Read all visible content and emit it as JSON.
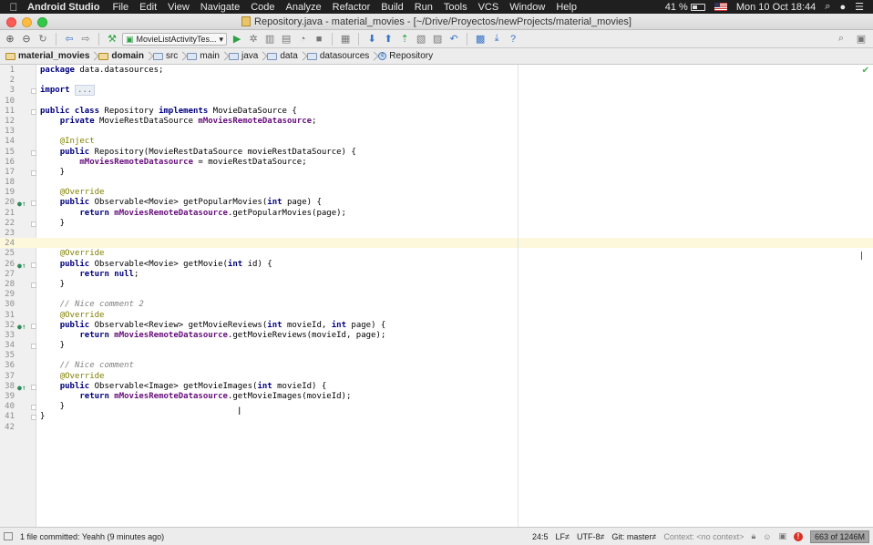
{
  "menubar": {
    "app_name": "Android Studio",
    "items": [
      "File",
      "Edit",
      "View",
      "Navigate",
      "Code",
      "Analyze",
      "Refactor",
      "Build",
      "Run",
      "Tools",
      "VCS",
      "Window",
      "Help"
    ],
    "battery": "41 %",
    "datetime": "Mon 10 Oct  18:44"
  },
  "window": {
    "title": "Repository.java - material_movies - [~/Drive/Proyectos/newProjects/material_movies]"
  },
  "toolbar": {
    "run_config": "MovieListActivityTes..."
  },
  "breadcrumb": [
    "material_movies",
    "domain",
    "src",
    "main",
    "java",
    "data",
    "datasources",
    "Repository"
  ],
  "editor": {
    "lines": [
      {
        "n": "1",
        "html": "<span class=\"kw\">package</span> data.datasources;"
      },
      {
        "n": "2",
        "html": ""
      },
      {
        "n": "3",
        "html": "<span class=\"kw\">import</span> <span class=\"fold-collapsed\">...</span>"
      },
      {
        "n": "10",
        "html": ""
      },
      {
        "n": "11",
        "html": "<span class=\"kw\">public class</span> Repository <span class=\"kw\">implements</span> MovieDataSource {"
      },
      {
        "n": "12",
        "html": "    <span class=\"kw\">private</span> MovieRestDataSource <span class=\"field\">mMoviesRemoteDatasource</span>;"
      },
      {
        "n": "13",
        "html": ""
      },
      {
        "n": "14",
        "html": "    <span class=\"ann\">@Inject</span>"
      },
      {
        "n": "15",
        "html": "    <span class=\"kw\">public</span> Repository(MovieRestDataSource movieRestDataSource) {"
      },
      {
        "n": "16",
        "html": "        <span class=\"field\">mMoviesRemoteDatasource</span> = movieRestDataSource;"
      },
      {
        "n": "17",
        "html": "    }"
      },
      {
        "n": "18",
        "html": ""
      },
      {
        "n": "19",
        "html": "    <span class=\"ann\">@Override</span>"
      },
      {
        "n": "20",
        "html": "    <span class=\"kw\">public</span> Observable&lt;Movie&gt; getPopularMovies(<span class=\"kw\">int</span> page) {"
      },
      {
        "n": "21",
        "html": "        <span class=\"kw\">return</span> <span class=\"field\">mMoviesRemoteDatasource</span>.getPopularMovies(page);"
      },
      {
        "n": "22",
        "html": "    }"
      },
      {
        "n": "23",
        "html": ""
      },
      {
        "n": "24",
        "html": ""
      },
      {
        "n": "25",
        "html": "    <span class=\"ann\">@Override</span>"
      },
      {
        "n": "26",
        "html": "    <span class=\"kw\">public</span> Observable&lt;Movie&gt; getMovie(<span class=\"kw\">int</span> id) {"
      },
      {
        "n": "27",
        "html": "        <span class=\"kw\">return null</span>;"
      },
      {
        "n": "28",
        "html": "    }"
      },
      {
        "n": "29",
        "html": ""
      },
      {
        "n": "30",
        "html": "    <span class=\"cmt\">// Nice comment 2</span>"
      },
      {
        "n": "31",
        "html": "    <span class=\"ann\">@Override</span>"
      },
      {
        "n": "32",
        "html": "    <span class=\"kw\">public</span> Observable&lt;Review&gt; getMovieReviews(<span class=\"kw\">int</span> movieId, <span class=\"kw\">int</span> page) {"
      },
      {
        "n": "33",
        "html": "        <span class=\"kw\">return</span> <span class=\"field\">mMoviesRemoteDatasource</span>.getMovieReviews(movieId, page);"
      },
      {
        "n": "34",
        "html": "    }"
      },
      {
        "n": "35",
        "html": ""
      },
      {
        "n": "36",
        "html": "    <span class=\"cmt\">// Nice comment</span>"
      },
      {
        "n": "37",
        "html": "    <span class=\"ann\">@Override</span>"
      },
      {
        "n": "38",
        "html": "    <span class=\"kw\">public</span> Observable&lt;Image&gt; getMovieImages(<span class=\"kw\">int</span> movieId) {"
      },
      {
        "n": "39",
        "html": "        <span class=\"kw\">return</span> <span class=\"field\">mMoviesRemoteDatasource</span>.getMovieImages(movieId);"
      },
      {
        "n": "40",
        "html": "    }"
      },
      {
        "n": "41",
        "html": "}"
      },
      {
        "n": "42",
        "html": ""
      }
    ],
    "override_marker_lines": [
      "20",
      "26",
      "32",
      "38"
    ],
    "fold_lines": [
      "3",
      "11",
      "15",
      "17",
      "20",
      "22",
      "26",
      "28",
      "32",
      "34",
      "38",
      "40",
      "41"
    ]
  },
  "statusbar": {
    "message": "1 file committed: Yeahh (9 minutes ago)",
    "position": "24:5",
    "line_sep": "LF≠",
    "encoding": "UTF-8≠",
    "git": "Git: master≠",
    "context": "Context: <no context>",
    "memory": "663 of 1246M"
  }
}
